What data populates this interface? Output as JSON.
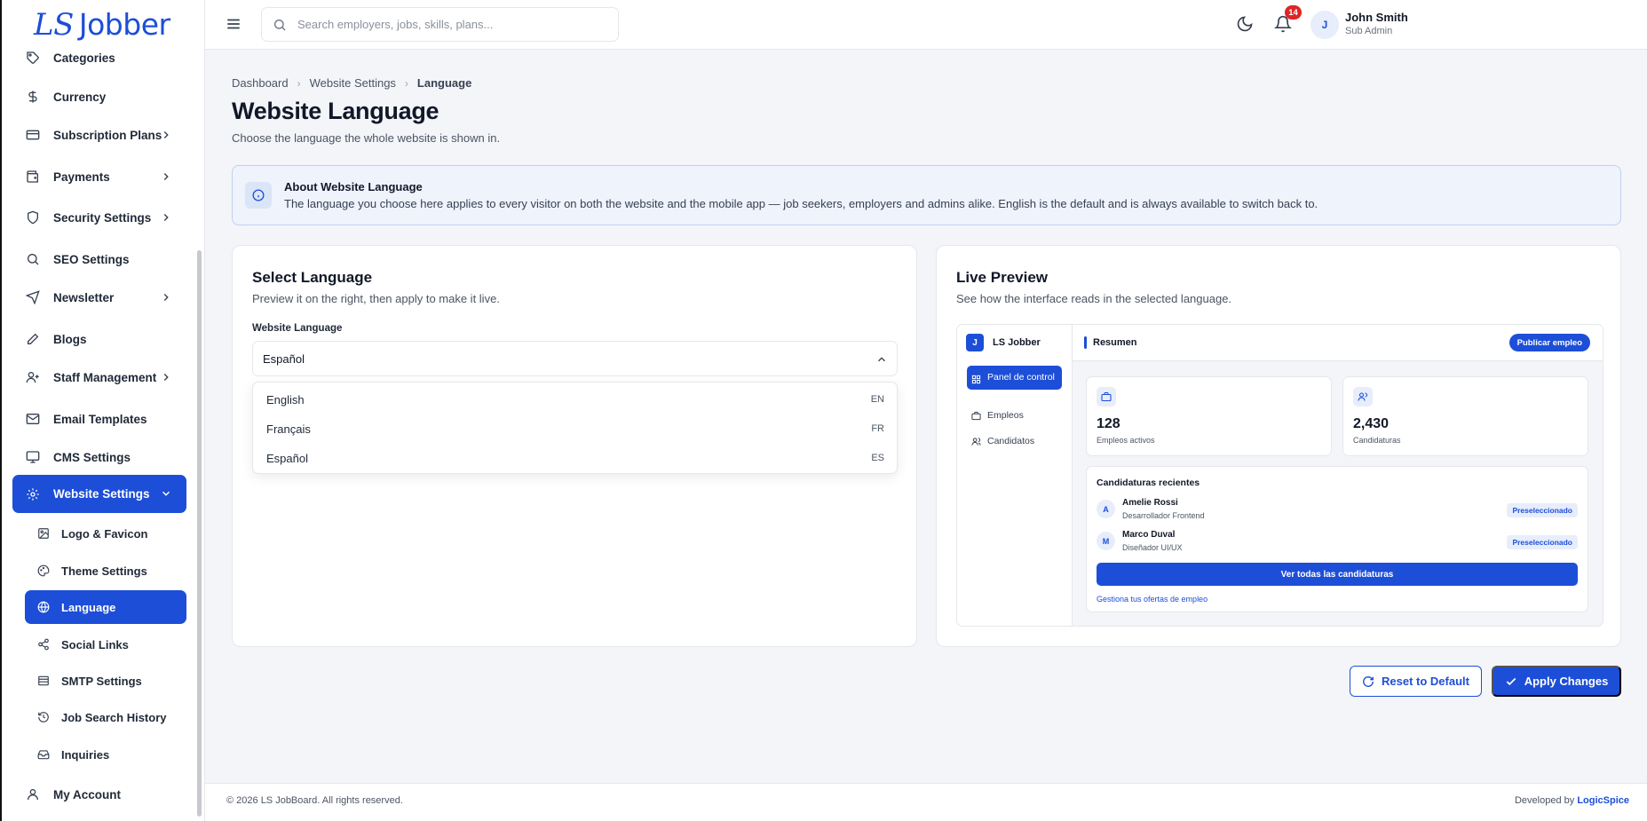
{
  "app": {
    "logo_prefix": "LS",
    "logo_name": "Jobber"
  },
  "sidebar": {
    "items": [
      {
        "label": "Categories",
        "icon": "tag-icon"
      },
      {
        "label": "Currency",
        "icon": "dollar-icon"
      },
      {
        "label": "Subscription Plans",
        "icon": "card-icon"
      },
      {
        "label": "Payments",
        "icon": "wallet-icon"
      },
      {
        "label": "Security Settings",
        "icon": "shield-icon"
      },
      {
        "label": "SEO Settings",
        "icon": "search-icon"
      },
      {
        "label": "Newsletter",
        "icon": "send-icon"
      },
      {
        "label": "Blogs",
        "icon": "pen-icon"
      },
      {
        "label": "Staff Management",
        "icon": "user-icon"
      },
      {
        "label": "Email Templates",
        "icon": "mail-icon"
      },
      {
        "label": "CMS Settings",
        "icon": "monitor-icon"
      },
      {
        "label": "Website Settings",
        "icon": "gear-icon"
      }
    ],
    "sub_items": [
      {
        "label": "Logo & Favicon",
        "icon": "image-icon"
      },
      {
        "label": "Theme Settings",
        "icon": "palette-icon"
      },
      {
        "label": "Language",
        "icon": "globe-icon"
      },
      {
        "label": "Social Links",
        "icon": "share-icon"
      },
      {
        "label": "SMTP Settings",
        "icon": "server-icon"
      },
      {
        "label": "Job Search History",
        "icon": "history-icon"
      },
      {
        "label": "Inquiries",
        "icon": "inbox-icon"
      }
    ],
    "account": {
      "label": "My Account",
      "icon": "user-icon"
    }
  },
  "topbar": {
    "search_placeholder": "Search employers, jobs, skills, plans...",
    "notification_count": "14",
    "user_initial": "J",
    "user_name": "John Smith",
    "user_role": "Sub Admin"
  },
  "breadcrumb": {
    "items": [
      "Dashboard",
      "Website Settings"
    ],
    "current": "Language"
  },
  "page": {
    "title": "Website Language",
    "subtitle": "Choose the language the whole website is shown in."
  },
  "info": {
    "title": "About Website Language",
    "body": "The language you choose here applies to every visitor on both the website and the mobile app — job seekers, employers and admins alike. English is the default and is always available to switch back to."
  },
  "select_card": {
    "title": "Select Language",
    "subtitle": "Preview it on the right, then apply to make it live.",
    "field_label": "Website Language",
    "selected": "Español",
    "options": [
      {
        "label": "English",
        "code": "EN"
      },
      {
        "label": "Français",
        "code": "FR"
      },
      {
        "label": "Español",
        "code": "ES"
      }
    ]
  },
  "preview_card": {
    "title": "Live Preview",
    "subtitle": "See how the interface reads in the selected language.",
    "app_initial": "J",
    "app_name": "LS Jobber",
    "nav": [
      "Panel de control",
      "Empleos",
      "Candidatos"
    ],
    "header_title": "Resumen",
    "header_button": "Publicar empleo",
    "stats": [
      {
        "value": "128",
        "label": "Empleos activos"
      },
      {
        "value": "2,430",
        "label": "Candidaturas"
      }
    ],
    "recent_title": "Candidaturas recientes",
    "candidates": [
      {
        "initial": "A",
        "name": "Amelie Rossi",
        "role": "Desarrollador Frontend",
        "status": "Preseleccionado"
      },
      {
        "initial": "M",
        "name": "Marco Duval",
        "role": "Diseñador UI/UX",
        "status": "Preseleccionado"
      }
    ],
    "view_all": "Ver todas las candidaturas",
    "manage_link": "Gestiona tus ofertas de empleo"
  },
  "actions": {
    "reset": "Reset to Default",
    "apply": "Apply Changes"
  },
  "footer": {
    "copyright": "© 2026 LS JobBoard. All rights reserved.",
    "developed_by": "Developed by",
    "developer": "LogicSpice"
  },
  "colors": {
    "accent": "#1d4ed8",
    "badge": "#dc2626"
  }
}
